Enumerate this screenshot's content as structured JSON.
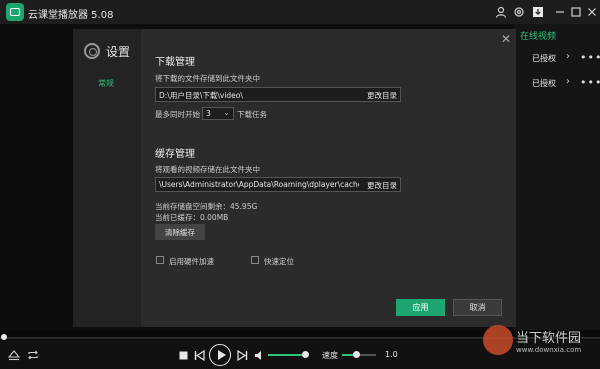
{
  "app": {
    "title": "云课堂播放器 5.08"
  },
  "right_panel": {
    "title": "在线视频",
    "rows": [
      {
        "label": "已授权"
      },
      {
        "label": "已授权"
      }
    ],
    "chevron": "›",
    "dots": "•••"
  },
  "dialog": {
    "title": "设置",
    "side_item": "常规",
    "download": {
      "section_title": "下载管理",
      "desc": "将下载的文件存储到此文件夹中",
      "path": "D:\\用户目录\\下载\\video\\",
      "change_btn": "更改目录",
      "concurrent_prefix": "最多同时开始",
      "concurrent_value": "3",
      "concurrent_suffix": "下载任务"
    },
    "cache": {
      "section_title": "缓存管理",
      "desc": "将观看的视频存储在此文件夹中",
      "path": "\\Users\\Administrator\\AppData\\Roaming\\dplayer\\cache\\",
      "change_btn": "更改目录",
      "free_space": "当前存储盘空间剩余：45.95G",
      "cached": "当前已缓存：0.00MB",
      "clear_btn": "清除缓存"
    },
    "options": {
      "hw_accel": "启用硬件加速",
      "fast_seek": "快速定位"
    },
    "apply_btn": "应用",
    "cancel_btn": "取消"
  },
  "controls": {
    "speed_label": "速度",
    "speed_value": "1.0",
    "volume_level": 0.85,
    "speed_level": 0.35
  },
  "watermark": {
    "text": "当下软件园",
    "url": "www.downxia.com"
  },
  "colors": {
    "accent": "#1ea672",
    "accent_text": "#2ec47d"
  }
}
